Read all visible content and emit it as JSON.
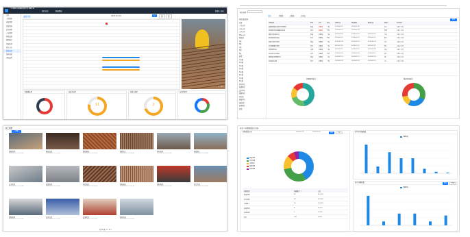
{
  "paneA": {
    "app_title": "广东省建筑工程集团有限公司 智慧工地",
    "nav": [
      "项目总览",
      "数据看板"
    ],
    "user": "管理员 | 退出",
    "sidebar": [
      "首页",
      "工程管理",
      "进度管理",
      "质量管理",
      "安全管理",
      "人员管理",
      "机械设备",
      "视频监控",
      "环境监测",
      "施工日志",
      "形象进度",
      "资料管理",
      "系统设置"
    ],
    "tool_label": "进度计划",
    "date_label": "2021-02-01",
    "tabs": [
      "日",
      "周",
      "月"
    ],
    "photo_caption": "1 / 10",
    "card1_title": "问题整改率",
    "card2_title": "进度完成率",
    "card2_value": "11",
    "card2_unit": "%",
    "card3_title": "质量合格率",
    "card3_value": "2",
    "card3_unit": "%",
    "card4_title": "安全检查率"
  },
  "paneB": {
    "search_label": "项目名称",
    "tabs": [
      "全部",
      "待整改",
      "已整改",
      "已完成"
    ],
    "new_button": "新增",
    "tree": [
      "项目组织机构",
      "  总部",
      "    一分公司",
      "    二分公司",
      "    三分公司",
      "    四分公司",
      "  项目部",
      "    A区",
      "    B区",
      "    C区",
      "    D区",
      "    E区",
      "  其他",
      "    1号楼",
      "    2号楼",
      "    3号楼",
      "    4号楼",
      "    5号楼",
      "    6号楼",
      "    7号楼",
      "    8号楼",
      "  外包单位",
      "  监理单位",
      "  设计单位",
      "  勘察单位",
      "  供应商",
      "  建设单位",
      "  政府部门",
      "  其他单位",
      "  其他"
    ],
    "table_headers": [
      "问题描述",
      "类型",
      "状态",
      "等级",
      "检查时间",
      "整改期限",
      "整改时间",
      "整改人",
      "责任单位"
    ],
    "rows": [
      [
        "基础钢筋绑扎间距不符合要求",
        "质量",
        "待整改",
        "一般",
        "2019-01-21",
        "2019-01-25",
        "",
        "张三",
        "工程一公司"
      ],
      [
        "现场临时用电线路私拉乱接",
        "安全",
        "待整改",
        "严重",
        "2019-01-21",
        "2019-01-24",
        "",
        "李四",
        "工程一公司"
      ],
      [
        "模板支撑间距过大",
        "质量",
        "已整改",
        "一般",
        "2019-01-20",
        "2019-01-23",
        "2019-01-22",
        "王五",
        "工程二公司"
      ],
      [
        "脚手架连墙件缺失",
        "安全",
        "已整改",
        "严重",
        "2019-01-19",
        "2019-01-22",
        "2019-01-21",
        "赵六",
        "工程二公司"
      ],
      [
        "混凝土养护不到位",
        "质量",
        "已整改",
        "一般",
        "2019-01-18",
        "2019-01-21",
        "2019-01-20",
        "孙七",
        "工程三公司"
      ],
      [
        "安全帽佩戴不规范",
        "安全",
        "已整改",
        "一般",
        "2019-01-18",
        "2019-01-20",
        "2019-01-19",
        "周八",
        "工程三公司"
      ],
      [
        "材料堆放杂乱",
        "文明",
        "已整改",
        "一般",
        "2019-01-17",
        "2019-01-19",
        "2019-01-18",
        "吴九",
        "工程一公司"
      ],
      [
        "洞口防护栏杆缺失",
        "安全",
        "已整改",
        "严重",
        "2019-01-16",
        "2019-01-18",
        "2019-01-17",
        "郑十",
        "工程二公司"
      ],
      [
        "钢筋保护层厚度不足",
        "质量",
        "已整改",
        "一般",
        "2019-01-15",
        "2019-01-17",
        "2019-01-16",
        "钱一",
        "工程三公司"
      ],
      [
        "消防器材过期",
        "安全",
        "已整改",
        "一般",
        "2019-01-14",
        "2019-01-16",
        "2019-01-15",
        "冯二",
        "工程一公司"
      ]
    ],
    "chart1_title": "问题类型统计",
    "chart2_title": "整改状态统计"
  },
  "paneC": {
    "title": "施工相册",
    "button": "上传图片",
    "photos": [
      {
        "name": "钢筋验收",
        "date": "2019-05-12 13:25:00"
      },
      {
        "name": "模板安装",
        "date": "2019-05-12 13:25:00"
      },
      {
        "name": "楼板钢筋",
        "date": "2019-05-12 13:25:00"
      },
      {
        "name": "钢筋加工",
        "date": "2019-05-12 13:25:00"
      },
      {
        "name": "材料进场",
        "date": "2019-05-12 13:25:00"
      },
      {
        "name": "基础施工",
        "date": "2019-05-12 13:25:00"
      },
      {
        "name": "安全检查",
        "date": "2019-05-12 13:25:00"
      },
      {
        "name": "质量验收",
        "date": "2019-05-12 13:25:00"
      },
      {
        "name": "现场巡查",
        "date": "2019-05-12 13:25:00"
      },
      {
        "name": "钢筋绑扎",
        "date": "2019-05-12 13:25:00"
      },
      {
        "name": "钢材堆放",
        "date": "2019-05-12 13:25:00"
      },
      {
        "name": "塔吊作业",
        "date": "2019-05-12 13:25:00"
      },
      {
        "name": "钢筋原材",
        "date": "2019-05-12 13:25:00"
      },
      {
        "name": "技术交底",
        "date": "2019-05-12 13:25:00"
      },
      {
        "name": "设备检查",
        "date": "2019-05-12 13:25:00"
      },
      {
        "name": "焊接作业",
        "date": "2019-05-12 13:25:00"
      },
      {
        "name": "现场布置",
        "date": "2019-05-12 13:25:00"
      },
      {
        "name": "主体结构",
        "date": "2019-05-12 13:25:00"
      }
    ],
    "footer": "共 18 条  < 1 2 >"
  },
  "paneD": {
    "breadcrumb": "首页 / 问题整改统计分析",
    "date_from": "2019-01-01",
    "date_to": "2019-12-31",
    "query": "查询",
    "export": "导出",
    "donut_box_title": "问题类型分布",
    "donut_legend": [
      "质量问题",
      "安全问题",
      "文明施工",
      "进度问题",
      "其他问题"
    ],
    "donut_values": [
      42,
      30,
      15,
      8,
      5
    ],
    "donut_colors": [
      "#1e88e5",
      "#43a047",
      "#fbc02d",
      "#e53935",
      "#8e24aa"
    ],
    "table_headers": [
      "问题类型",
      "问题数(个)",
      "占比"
    ],
    "table_rows": [
      [
        "质量问题",
        "42",
        "42.00%"
      ],
      [
        "安全问题",
        "30",
        "30.00%"
      ],
      [
        "文明施工",
        "15",
        "15.00%"
      ],
      [
        "进度问题",
        "8",
        "8.00%"
      ],
      [
        "其他问题",
        "5",
        "5.00%"
      ],
      [
        "合计",
        "100",
        "100%"
      ]
    ],
    "bar1_title": "各单位问题数量",
    "bar1_legend": "问题数量",
    "bar1_values": [
      38,
      9,
      28,
      20,
      20,
      6,
      2,
      1
    ],
    "bar2_title": "各月问题数量",
    "bar2_legend": "问题数量",
    "bar2_values": [
      30,
      4,
      12,
      12,
      4,
      10
    ]
  },
  "chart_data": [
    {
      "type": "pie",
      "categories": [
        "质量问题",
        "安全问题",
        "文明施工",
        "进度问题",
        "其他问题"
      ],
      "values": [
        42,
        30,
        15,
        8,
        5
      ]
    },
    {
      "type": "bar",
      "values": [
        38,
        9,
        28,
        20,
        20,
        6,
        2,
        1
      ],
      "series": [
        {
          "name": "问题数量",
          "values": [
            38,
            9,
            28,
            20,
            20,
            6,
            2,
            1
          ]
        }
      ]
    },
    {
      "type": "bar",
      "values": [
        30,
        4,
        12,
        12,
        4,
        10
      ],
      "series": [
        {
          "name": "问题数量",
          "values": [
            30,
            4,
            12,
            12,
            4,
            10
          ]
        }
      ]
    }
  ]
}
